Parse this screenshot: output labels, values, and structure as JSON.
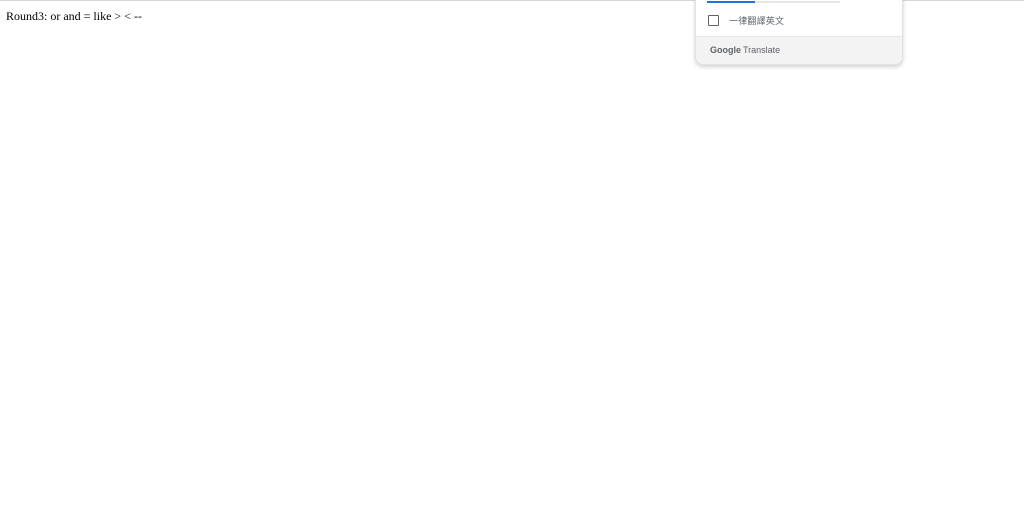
{
  "page": {
    "text": "Round3: or and = like > < --"
  },
  "translate_popup": {
    "always_translate_label": "一律翻譯英文",
    "always_translate_checked": false,
    "brand_google": "Google",
    "brand_translate": "Translate",
    "accent_color": "#1a73e8"
  }
}
